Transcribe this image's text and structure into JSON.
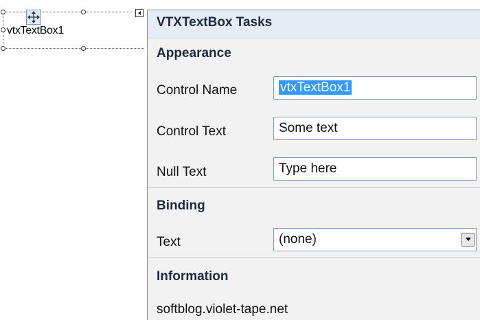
{
  "designer": {
    "control_text": "vtxTextBox1"
  },
  "panel": {
    "title": "VTXTextBox Tasks",
    "appearance": {
      "heading": "Appearance",
      "control_name": {
        "label": "Control Name",
        "value": "vtxTextBox1"
      },
      "control_text": {
        "label": "Control Text",
        "value": "Some text"
      },
      "null_text": {
        "label": "Null Text",
        "value": "Type here"
      }
    },
    "binding": {
      "heading": "Binding",
      "text": {
        "label": "Text",
        "value": "(none)"
      }
    },
    "information": {
      "heading": "Information",
      "text": "softblog.violet-tape.net"
    }
  },
  "colors": {
    "header_bg": "#e6ecf5",
    "panel_bg": "#f2f2f2",
    "selection": "#3399ff"
  }
}
